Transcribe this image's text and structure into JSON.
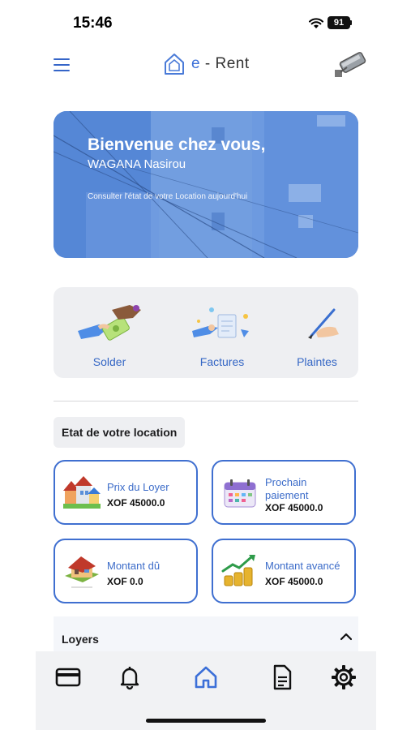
{
  "status_bar": {
    "time": "15:46",
    "battery": "91"
  },
  "header": {
    "brand_prefix": "e",
    "brand_separator": "-",
    "brand_name": "Rent",
    "menu_icon": "hamburger-menu-icon",
    "camera_icon": "security-camera-icon"
  },
  "hero": {
    "title": "Bienvenue chez vous,",
    "user_name": "WAGANA Nasirou",
    "subtitle": "Consulter l'état de votre Location aujourd'hui"
  },
  "quick_actions": [
    {
      "label": "Solder",
      "icon": "payment-hand-icon"
    },
    {
      "label": "Factures",
      "icon": "invoice-icon"
    },
    {
      "label": "Plaintes",
      "icon": "writing-hand-icon"
    }
  ],
  "rental_status": {
    "section_title": "Etat de votre location",
    "cards": [
      {
        "title": "Prix du Loyer",
        "value": "XOF 45000.0",
        "icon": "houses-icon"
      },
      {
        "title": "Prochain paiement",
        "value": "XOF 45000.0",
        "icon": "calendar-icon"
      },
      {
        "title": "Montant dû",
        "value": "XOF 0.0",
        "icon": "house-icon"
      },
      {
        "title": "Montant avancé",
        "value": "XOF 45000.0",
        "icon": "growth-coins-icon"
      }
    ]
  },
  "loyers": {
    "label": "Loyers",
    "expanded": true
  },
  "tab_bar": {
    "items": [
      "card-icon",
      "bell-icon",
      "home-icon",
      "document-icon",
      "settings-icon"
    ],
    "active": "home-icon"
  },
  "colors": {
    "accent": "#3b6fd8",
    "card_border": "#3f6fd0",
    "panel": "#eeeff2"
  }
}
